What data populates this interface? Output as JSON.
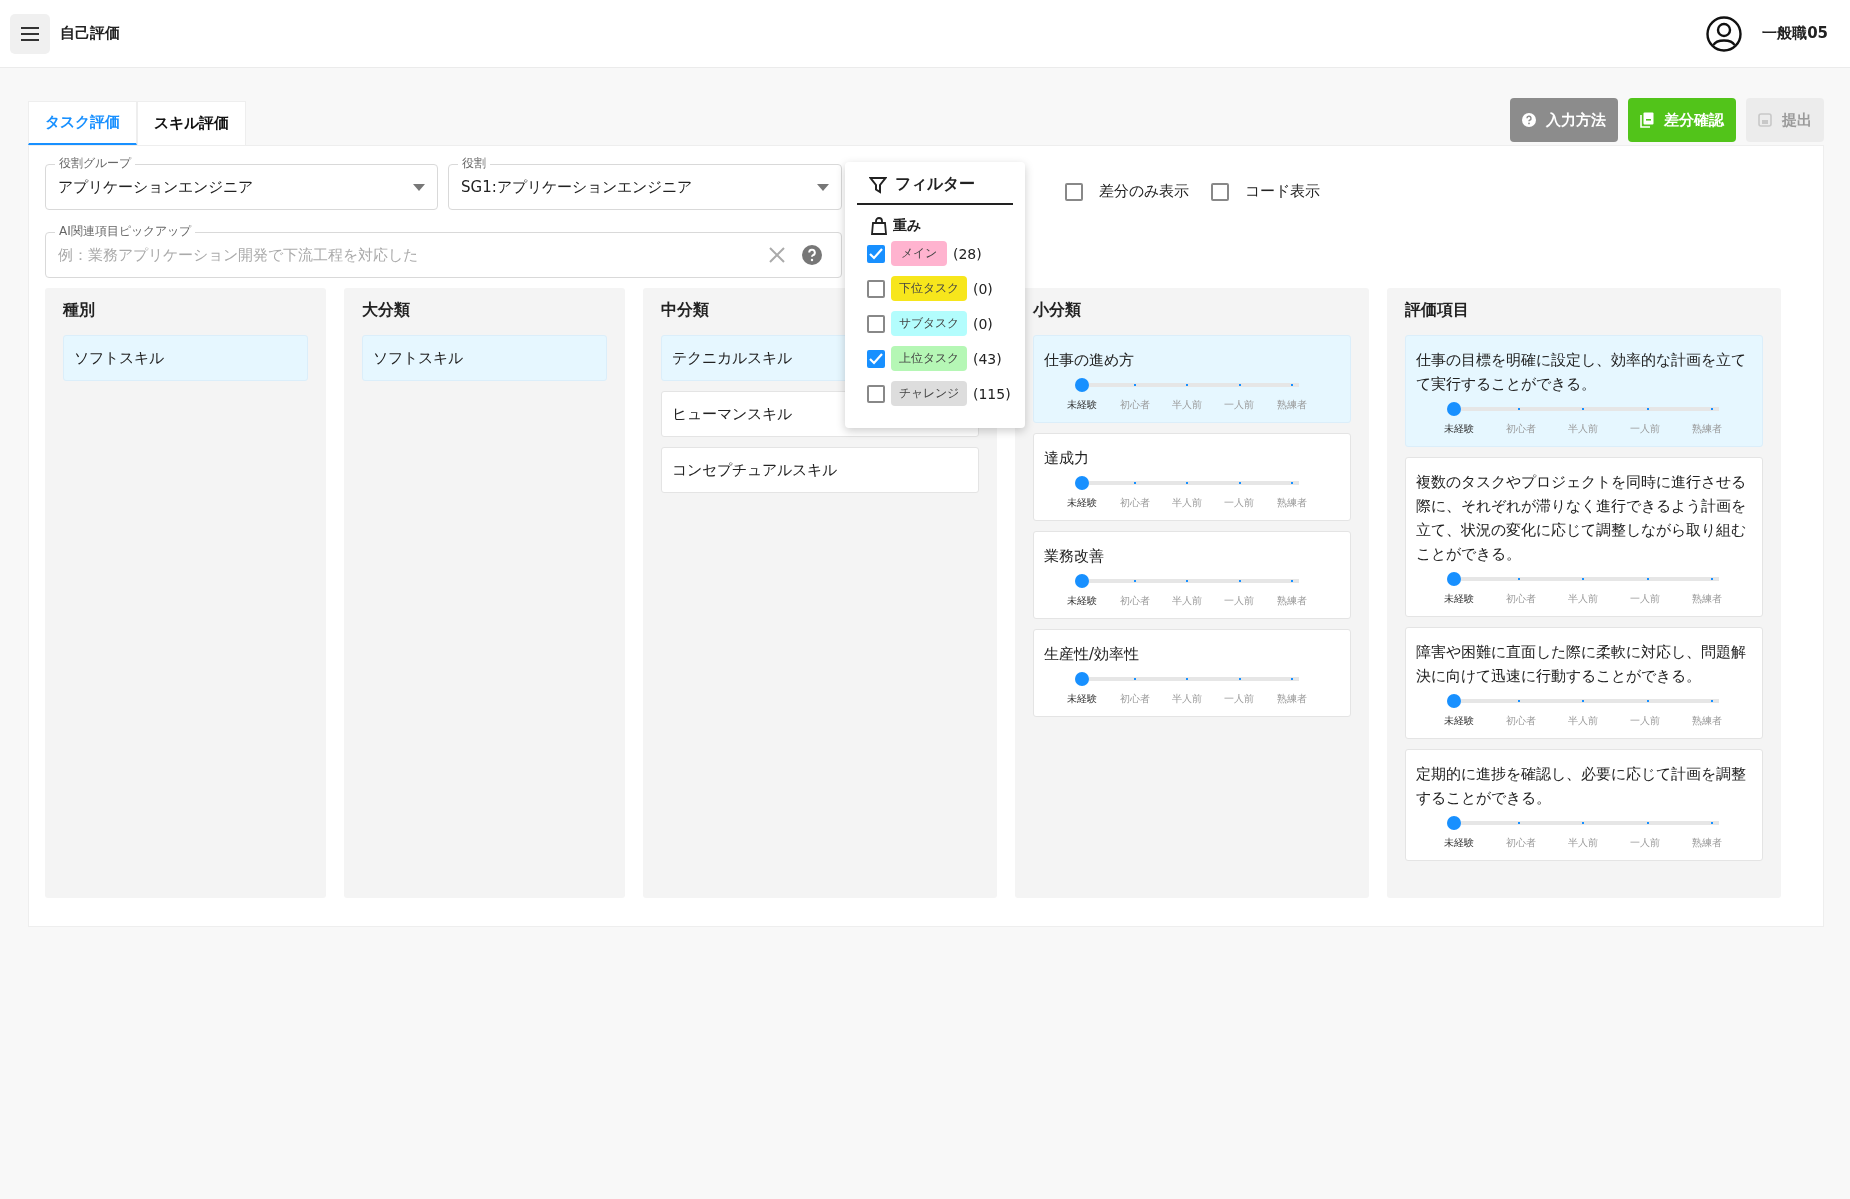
{
  "header": {
    "title": "自己評価",
    "user": "一般職05"
  },
  "tabs": [
    {
      "label": "タスク評価",
      "selected": true
    },
    {
      "label": "スキル評価",
      "selected": false
    }
  ],
  "actions": [
    {
      "label": "入力方法",
      "kind": "help",
      "disabled": false
    },
    {
      "label": "差分確認",
      "kind": "diff",
      "disabled": false
    },
    {
      "label": "提出",
      "kind": "submit",
      "disabled": true
    }
  ],
  "selects": [
    {
      "label": "役割グループ",
      "value": "アプリケーションエンジニア"
    },
    {
      "label": "役割",
      "value": "SG1:アプリケーションエンジニア"
    }
  ],
  "filter": {
    "title": "フィルター",
    "section": "重み",
    "options": [
      {
        "label": "メイン",
        "count": "(28)",
        "checked": true,
        "color": "#ffb3cf"
      },
      {
        "label": "下位タスク",
        "count": "(0)",
        "checked": false,
        "color": "#f7e61c"
      },
      {
        "label": "サブタスク",
        "count": "(0)",
        "checked": false,
        "color": "#b3fdfd"
      },
      {
        "label": "上位タスク",
        "count": "(43)",
        "checked": true,
        "color": "#b5f7b5"
      },
      {
        "label": "チャレンジ",
        "count": "(115)",
        "checked": false,
        "color": "#dddddd"
      }
    ]
  },
  "toggles": [
    {
      "label": "差分のみ表示",
      "checked": false
    },
    {
      "label": "コード表示",
      "checked": false
    }
  ],
  "ai_field": {
    "label": "AI関連項目ピックアップ",
    "placeholder": "例：業務アプリケーション開発で下流工程を対応した"
  },
  "columns": [
    {
      "title": "種別",
      "kind": "list",
      "items": [
        {
          "label": "ソフトスキル",
          "selected": true
        }
      ]
    },
    {
      "title": "大分類",
      "kind": "list",
      "items": [
        {
          "label": "ソフトスキル",
          "selected": true
        }
      ]
    },
    {
      "title": "中分類",
      "kind": "list",
      "items": [
        {
          "label": "テクニカルスキル",
          "selected": true
        },
        {
          "label": "ヒューマンスキル",
          "selected": false
        },
        {
          "label": "コンセプチュアルスキル",
          "selected": false
        }
      ]
    },
    {
      "title": "小分類",
      "kind": "slider",
      "items": [
        {
          "label": "仕事の進め方",
          "selected": true,
          "level": 0,
          "scale": [
            "未経験",
            "初心者",
            "半人前",
            "一人前",
            "熟練者"
          ]
        },
        {
          "label": "達成力",
          "selected": false,
          "level": 0,
          "scale": [
            "未経験",
            "初心者",
            "半人前",
            "一人前",
            "熟練者"
          ]
        },
        {
          "label": "業務改善",
          "selected": false,
          "level": 0,
          "scale": [
            "未経験",
            "初心者",
            "半人前",
            "一人前",
            "熟練者"
          ]
        },
        {
          "label": "生産性/効率性",
          "selected": false,
          "level": 0,
          "scale": [
            "未経験",
            "初心者",
            "半人前",
            "一人前",
            "熟練者"
          ]
        }
      ]
    },
    {
      "title": "評価項目",
      "kind": "slider",
      "items": [
        {
          "label": "仕事の目標を明確に設定し、効率的な計画を立てて実行することができる。",
          "selected": true,
          "level": 0,
          "scale": [
            "未経験",
            "初心者",
            "半人前",
            "一人前",
            "熟練者"
          ]
        },
        {
          "label": "複数のタスクやプロジェクトを同時に進行させる際に、それぞれが滞りなく進行できるよう計画を立て、状況の変化に応じて調整しながら取り組むことができる。",
          "selected": false,
          "level": 0,
          "scale": [
            "未経験",
            "初心者",
            "半人前",
            "一人前",
            "熟練者"
          ]
        },
        {
          "label": "障害や困難に直面した際に柔軟に対応し、問題解決に向けて迅速に行動することができる。",
          "selected": false,
          "level": 0,
          "scale": [
            "未経験",
            "初心者",
            "半人前",
            "一人前",
            "熟練者"
          ]
        },
        {
          "label": "定期的に進捗を確認し、必要に応じて計画を調整することができる。",
          "selected": false,
          "level": 0,
          "scale": [
            "未経験",
            "初心者",
            "半人前",
            "一人前",
            "熟練者"
          ]
        }
      ]
    }
  ]
}
